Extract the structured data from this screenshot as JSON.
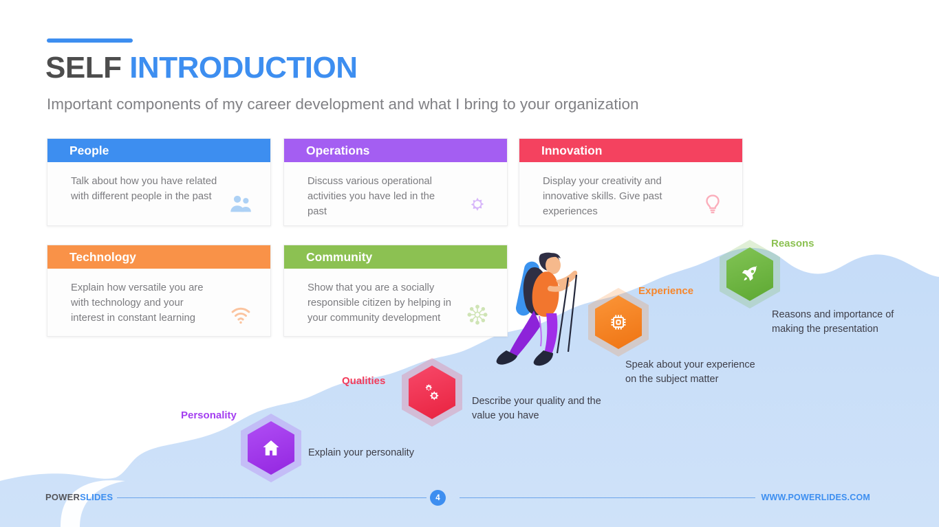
{
  "header": {
    "title_part1": "SELF",
    "title_part2": "INTRODUCTION",
    "subtitle": "Important components of my career development and what I bring to your organization",
    "accent_color": "#3d8ef0"
  },
  "cards": [
    {
      "title": "People",
      "text": "Talk about how you have related with different people in the past",
      "color": "#3d8ef0",
      "icon": "users-icon"
    },
    {
      "title": "Operations",
      "text": "Discuss various operational activities you have led in the past",
      "color": "#a45ef2",
      "icon": "gear-icon"
    },
    {
      "title": "Innovation",
      "text": "Display your creativity and innovative skills. Give past experiences",
      "color": "#f4425f",
      "icon": "lightbulb-icon"
    },
    {
      "title": "Technology",
      "text": "Explain how versatile you are with technology and your interest in constant learning",
      "color": "#f99248",
      "icon": "wifi-icon"
    },
    {
      "title": "Community",
      "text": "Show that you are a socially responsible citizen by helping in your community development",
      "color": "#8cc152",
      "icon": "network-hub-icon"
    }
  ],
  "milestones": [
    {
      "label": "Personality",
      "description": "Explain your personality",
      "color": "#a33ef0",
      "icon": "home-icon"
    },
    {
      "label": "Qualities",
      "description": "Describe your quality and the value you have",
      "color": "#f23b5a",
      "icon": "gears-icon"
    },
    {
      "label": "Experience",
      "description": "Speak about your experience on the subject matter",
      "color": "#f7862a",
      "icon": "cpu-chip-icon"
    },
    {
      "label": "Reasons",
      "description": "Reasons and importance of making the presentation",
      "color": "#70b844",
      "icon": "rocket-icon"
    }
  ],
  "illustration": {
    "name": "hiker-climbing-mountain",
    "shirt_color": "#f2762e",
    "pants_color": "#8d23d9",
    "mat_color": "#3b93ef",
    "backpack_color": "#2f2f44"
  },
  "background": {
    "mountain_color": "#c7ddf7",
    "slide_color": "#ffffff"
  },
  "footer": {
    "logo_part1": "POWER",
    "logo_part2": "SLIDES",
    "page_number": "4",
    "url": "WWW.POWERLIDES.COM"
  }
}
